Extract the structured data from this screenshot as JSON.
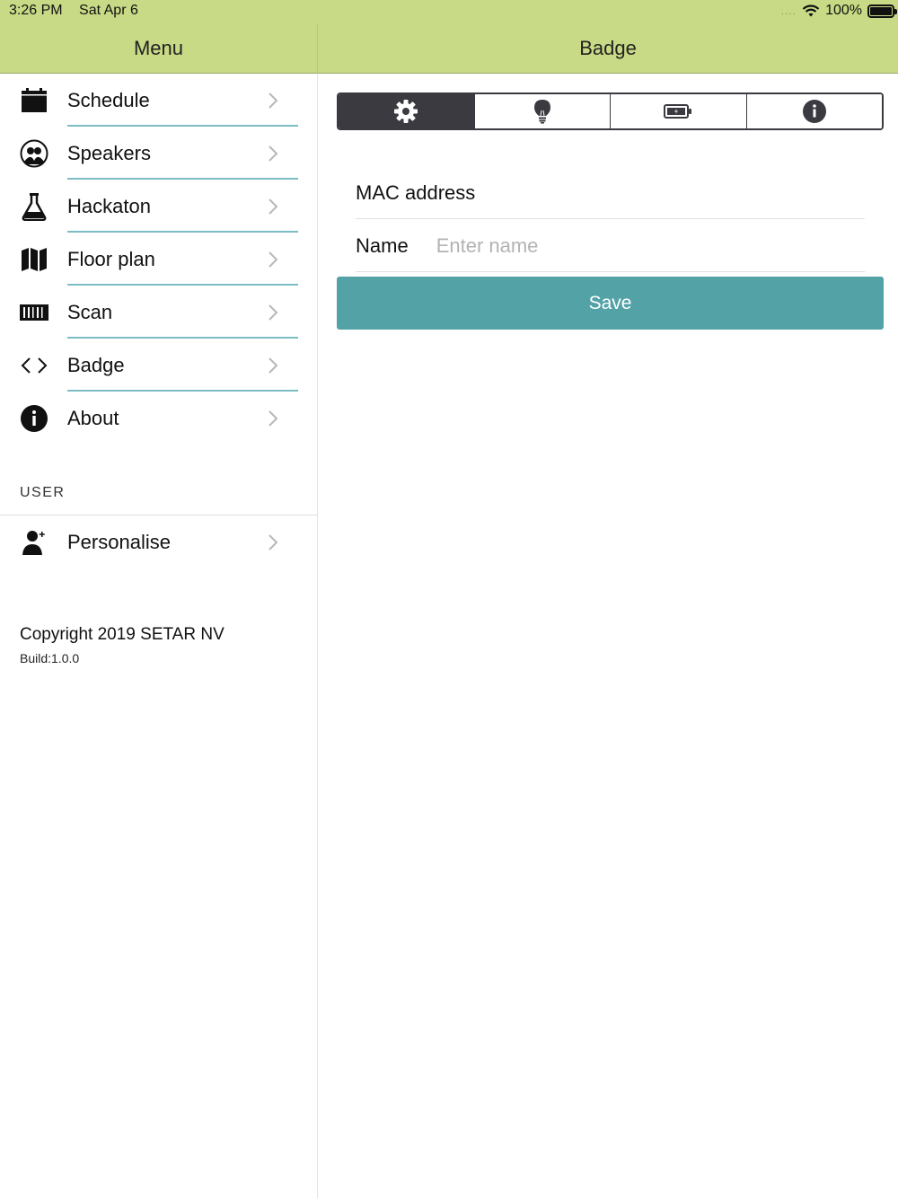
{
  "status_bar": {
    "time": "3:26 PM",
    "date": "Sat Apr 6",
    "signal": "....",
    "battery_level": "100%"
  },
  "sidebar": {
    "title": "Menu",
    "items": [
      {
        "label": "Schedule",
        "icon": "calendar-icon"
      },
      {
        "label": "Speakers",
        "icon": "people-icon"
      },
      {
        "label": "Hackaton",
        "icon": "flask-icon"
      },
      {
        "label": "Floor plan",
        "icon": "map-icon"
      },
      {
        "label": "Scan",
        "icon": "barcode-icon"
      },
      {
        "label": "Badge",
        "icon": "code-icon"
      },
      {
        "label": "About",
        "icon": "info-icon"
      }
    ],
    "user_section": {
      "header": "USER",
      "items": [
        {
          "label": "Personalise",
          "icon": "user-add-icon"
        }
      ]
    },
    "copyright": "Copyright 2019 SETAR NV",
    "build": "Build:1.0.0"
  },
  "main": {
    "title": "Badge",
    "tabs": [
      {
        "icon": "gear-icon",
        "active": true
      },
      {
        "icon": "lightbulb-icon",
        "active": false
      },
      {
        "icon": "battery-icon",
        "active": false
      },
      {
        "icon": "info-icon",
        "active": false
      }
    ],
    "mac_label": "MAC address",
    "name_label": "Name",
    "name_placeholder": "Enter name",
    "name_value": "",
    "save_label": "Save"
  },
  "colors": {
    "header_bg": "#c8da85",
    "accent": "#53a2a6",
    "separator": "#7cbcc4",
    "segment_dark": "#3a3a40"
  }
}
